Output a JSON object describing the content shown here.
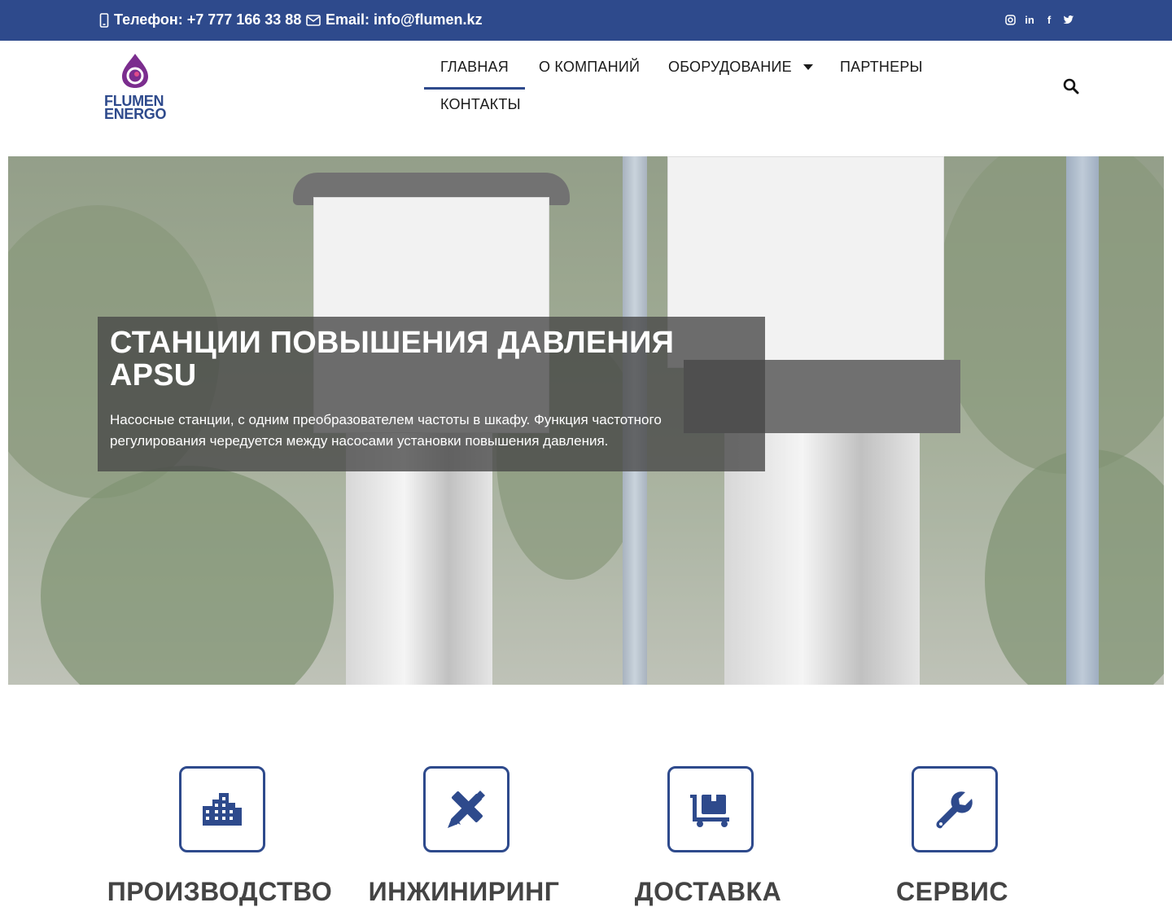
{
  "topbar": {
    "phone": "Телефон: +7 777 166 33 88",
    "email": "Email: info@flumen.kz",
    "social": [
      "instagram-icon",
      "linkedin-icon",
      "facebook-icon",
      "twitter-icon"
    ]
  },
  "logo": {
    "line1": "FLUMEN",
    "line2": "ENERGO"
  },
  "nav": {
    "items": [
      "ГЛАВНАЯ",
      "О КОМПАНИЙ",
      "ОБОРУДОВАНИЕ",
      "ПАРТНЕРЫ",
      "КОНТАКТЫ"
    ],
    "active": "ГЛАВНАЯ"
  },
  "hero": {
    "title": "СТАНЦИИ ПОВЫШЕНИЯ ДАВЛЕНИЯ APSU",
    "text": "Насосные станции, с одним преобразователем частоты в шкафу. Функция частотного регулирования чередуется между насосами установки повышения давления."
  },
  "services": [
    {
      "icon": "factory-icon",
      "title": "ПРОИЗВОДСТВО"
    },
    {
      "icon": "engineering-icon",
      "title": "ИНЖИНИРИНГ"
    },
    {
      "icon": "delivery-cart-icon",
      "title": "ДОСТАВКА"
    },
    {
      "icon": "wrench-icon",
      "title": "СЕРВИС"
    }
  ],
  "colors": {
    "brand": "#2e4a8c",
    "logo_accent": "#7b2d8e"
  }
}
